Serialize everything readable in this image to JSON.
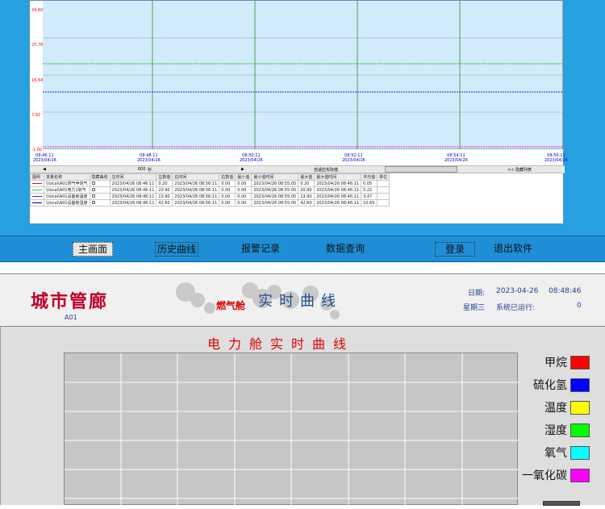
{
  "history": {
    "y_ticks": [
      "34.60",
      "25.76",
      "16.84",
      "7.92",
      "-1.00"
    ],
    "x_ticks": [
      {
        "time": "08:46:11",
        "date": "2023/04/26"
      },
      {
        "time": "08:48:11",
        "date": "2023/04/26"
      },
      {
        "time": "08:50:11",
        "date": "2023/04/26"
      },
      {
        "time": "08:52:11",
        "date": "2023/04/26"
      },
      {
        "time": "08:54:11",
        "date": "2023/04/26"
      },
      {
        "time": "08:56:11",
        "date": "2023/04/26"
      }
    ],
    "scroll": {
      "left_arrow": "◀",
      "span": "600",
      "span_unit": "秒",
      "right_arrow": "▶",
      "auto_label": "自适应实际值",
      "hide_list": "<< 隐藏列表"
    },
    "table": {
      "headers": [
        "图例",
        "变量名称",
        "隐藏曲线",
        "左时间",
        "左数值",
        "右时间",
        "右数值",
        "最小值",
        "最小值时间",
        "最大值",
        "最大值时间",
        "平均值",
        "单位"
      ],
      "rows": [
        {
          "color": "#ff0000",
          "name": "\\\\local\\A01燃气甲烷气",
          "left_time": "2023/04/26 08:46:11",
          "left_val": "0.20",
          "right_time": "2023/04/26 08:56:11",
          "right_val": "0.00",
          "min": "0.00",
          "min_time": "2023/04/26 08:55:05",
          "max": "0.20",
          "max_time": "2023/04/26 08:46:11",
          "avg": "0.05",
          "unit": ""
        },
        {
          "color": "#33cc33",
          "name": "\\\\local\\A01电力1氧气",
          "left_time": "2023/04/26 08:46:11",
          "left_val": "20.90",
          "right_time": "2023/04/26 08:56:11",
          "right_val": "0.00",
          "min": "0.00",
          "min_time": "2023/04/26 08:55:05",
          "max": "20.90",
          "max_time": "2023/04/26 08:46:11",
          "avg": "5.22",
          "unit": ""
        },
        {
          "color": "#2222ff",
          "name": "\\\\local\\A01设备舱温度",
          "left_time": "2023/04/26 08:46:11",
          "left_val": "13.90",
          "right_time": "2023/04/26 08:56:11",
          "right_val": "0.00",
          "min": "0.00",
          "min_time": "2023/04/26 08:55:05",
          "max": "13.90",
          "max_time": "2023/04/26 08:46:11",
          "avg": "3.47",
          "unit": ""
        },
        {
          "color": "#000080",
          "name": "\\\\local\\A01设备舱湿度",
          "left_time": "2023/04/26 08:46:11",
          "left_val": "42.60",
          "right_time": "2023/04/26 08:56:11",
          "right_val": "0.00",
          "min": "0.00",
          "min_time": "2023/04/26 08:55:05",
          "max": "42.60",
          "max_time": "2023/04/26 08:46:11",
          "avg": "10.65",
          "unit": ""
        }
      ]
    }
  },
  "nav": {
    "main": "主画面",
    "history": "历史曲线",
    "alarm": "报警记录",
    "query": "数据查询",
    "login": "登录",
    "exit": "退出软件"
  },
  "header": {
    "title": "城市管廊",
    "subtitle": "A01",
    "cabin": "燃气舱",
    "screen_title": "实时曲线",
    "date_label": "日期:",
    "date": "2023-04-26",
    "time": "08:48:46",
    "weekday": "星期三",
    "runtime_label": "系统已运行:",
    "runtime": "0"
  },
  "realtime": {
    "title": "电力舱实时曲线",
    "legend": [
      {
        "label": "甲烷",
        "color": "#ff0000"
      },
      {
        "label": "硫化氢",
        "color": "#0000ff"
      },
      {
        "label": "温度",
        "color": "#ffff00"
      },
      {
        "label": "湿度",
        "color": "#00ff00"
      },
      {
        "label": "氧气",
        "color": "#00ffff"
      },
      {
        "label": "一氧化碳",
        "color": "#ff00ff"
      }
    ]
  }
}
